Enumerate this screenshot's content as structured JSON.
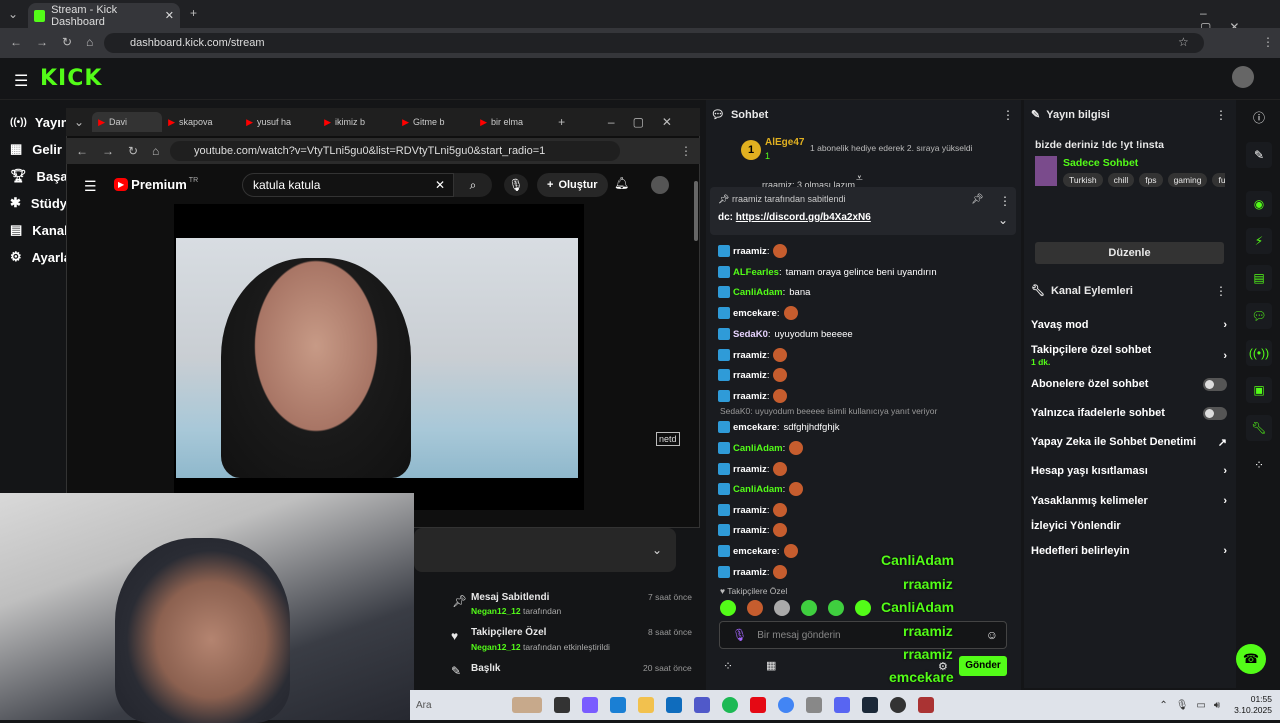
{
  "browser": {
    "tab_title": "Stream - Kick Dashboard",
    "url": "dashboard.kick.com/stream"
  },
  "sidebar": {
    "items": [
      "Yayın",
      "Gelir",
      "Başarı",
      "Stüdyo",
      "Kanal",
      "Ayarla"
    ]
  },
  "youtube": {
    "tabs": [
      "Davi",
      "skapova",
      "yusuf ha",
      "ikimiz b",
      "Gitme b",
      "bir elma"
    ],
    "url": "youtube.com/watch?v=VtyTLni5gu0&list=RDVtyTLni5gu0&start_radio=1",
    "logo": "Premium",
    "region": "TR",
    "search_value": "katula katula",
    "create_label": "Oluştur",
    "watermark": "netd"
  },
  "chat": {
    "title": "Sohbet",
    "top_user": "AlEge47",
    "top_count": "1",
    "top_notice": "1 abonelik hediye ederek 2. sıraya yükseldi",
    "pinned_prev": "rraamiz: 3 olması lazım",
    "pinned_by": "rraamiz tarafından sabitlendi",
    "pinned_text_prefix": "dc:",
    "pinned_link": "https://discord.gg/b4Xa2xN6",
    "messages": [
      {
        "user": "rraamiz",
        "text": ""
      },
      {
        "user": "ALFearles",
        "text": "tamam oraya gelince beni uyandırın"
      },
      {
        "user": "CanliAdam",
        "text": "bana"
      },
      {
        "user": "emcekare",
        "text": ""
      },
      {
        "user": "SedaK0",
        "text": "uyuyodum beeeee"
      },
      {
        "user": "rraamiz",
        "text": ""
      },
      {
        "user": "rraamiz",
        "text": ""
      },
      {
        "user": "rraamiz",
        "text": ""
      },
      {
        "user": "emcekare",
        "text": "sdfghjhdfghjk"
      },
      {
        "user": "CanliAdam",
        "text": ""
      },
      {
        "user": "rraamiz",
        "text": ""
      },
      {
        "user": "CanliAdam",
        "text": ""
      },
      {
        "user": "rraamiz",
        "text": ""
      },
      {
        "user": "rraamiz",
        "text": ""
      },
      {
        "user": "emcekare",
        "text": ""
      },
      {
        "user": "rraamiz",
        "text": ""
      }
    ],
    "reply_hint": "SedaK0: uyuyodum beeeee isimli kullanıcıya yanıt veriyor",
    "followers_only": "Takipçilere Özel",
    "input_placeholder": "Bir mesaj gönderin",
    "send_label": "Gönder"
  },
  "stream_info": {
    "title": "Yayın bilgisi",
    "stream_title": "bizde deriniz !dc !yt !insta",
    "category": "Sadece Sohbet",
    "tags": [
      "Turkish",
      "chill",
      "fps",
      "gaming",
      "fu"
    ],
    "edit_label": "Düzenle"
  },
  "channel_actions": {
    "title": "Kanal Eylemleri",
    "items": [
      {
        "label": "Yavaş mod"
      },
      {
        "label": "Takipçilere özel sohbet",
        "sub": "1 dk."
      },
      {
        "label": "Abonelere özel sohbet"
      },
      {
        "label": "Yalnızca ifadelerle sohbet"
      },
      {
        "label": "Yapay Zeka ile Sohbet Denetimi"
      },
      {
        "label": "Hesap yaşı kısıtlaması"
      },
      {
        "label": "Yasaklanmış kelimeler"
      },
      {
        "label": "İzleyici Yönlendir"
      },
      {
        "label": "Hedefleri belirleyin"
      }
    ]
  },
  "activity": [
    {
      "title": "Mesaj Sabitlendi",
      "user": "Negan12_12",
      "suffix": "tarafından",
      "time": "7 saat önce"
    },
    {
      "title": "Takipçilere Özel",
      "user": "Negan12_12",
      "suffix": "tarafından etkinleştirildi",
      "time": "8 saat önce"
    },
    {
      "title": "Başlık",
      "user": "",
      "suffix": "",
      "time": "20 saat önce"
    }
  ],
  "overlay_names": [
    "CanliAdam",
    "rraamiz",
    "CanliAdam",
    "rraamiz",
    "rraamiz",
    "emcekare"
  ],
  "taskbar": {
    "search": "Ara",
    "time": "01:55",
    "date": "3.10.2025"
  },
  "colors": {
    "kick_green": "#53fc18",
    "panel": "#191b1f"
  }
}
